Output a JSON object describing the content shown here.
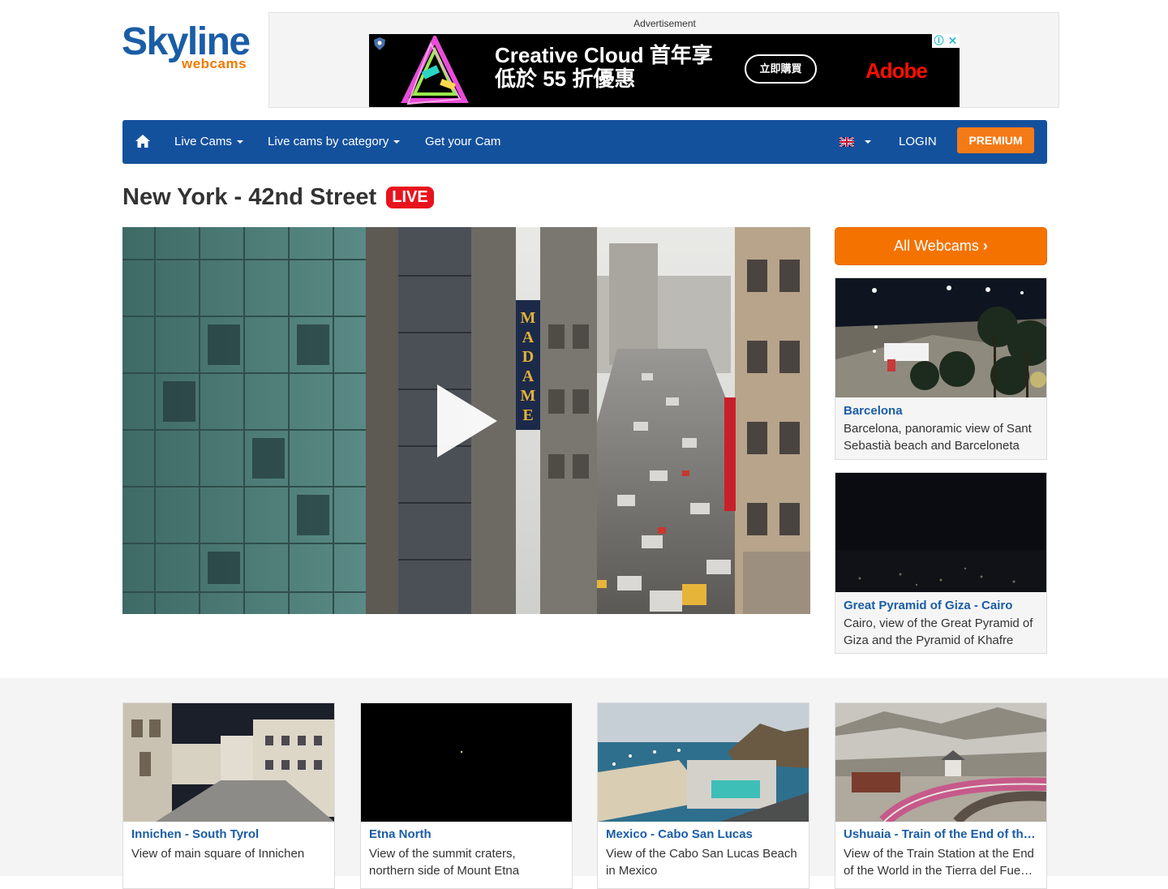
{
  "brand": {
    "logo_main": "Skyline",
    "logo_sub": "webcams"
  },
  "ad": {
    "label": "Advertisement",
    "headline": "Creative Cloud 首年享\n低於 55 折優惠",
    "cta": "立即購買",
    "brand": "Adobe",
    "info_icon": "ⓘ",
    "close_icon": "✕"
  },
  "nav": {
    "home_icon": "home-icon",
    "live_cams": "Live Cams",
    "by_category": "Live cams by category",
    "get_cam": "Get your Cam",
    "language_flag": "uk-flag-icon",
    "login": "LOGIN",
    "premium": "PREMIUM"
  },
  "page": {
    "title": "New York - 42nd Street",
    "live_badge": "LIVE"
  },
  "player": {
    "sign_text": "MADAME",
    "play_icon": "play-icon"
  },
  "sidebar": {
    "all_webcams": "All Webcams",
    "chevron": "›",
    "cards": [
      {
        "title": "Barcelona",
        "desc": "Barcelona, panoramic view of Sant Sebastià beach and Barceloneta"
      },
      {
        "title": "Great Pyramid of Giza - Cairo",
        "desc": "Cairo, view of the Great Pyramid of Giza and the Pyramid of Khafre"
      }
    ]
  },
  "grid": [
    {
      "title": "Innichen - South Tyrol",
      "desc": "View of main square of Innichen"
    },
    {
      "title": "Etna North",
      "desc": "View of the summit craters, northern side of Mount Etna"
    },
    {
      "title": "Mexico - Cabo San Lucas",
      "desc": "View of the Cabo San Lucas Beach in Mexico"
    },
    {
      "title": "Ushuaia - Train of the End of th…",
      "desc": "View of the Train Station at the End of the World in the Tierra del Fue…"
    }
  ],
  "colors": {
    "brand_blue": "#14519d",
    "accent_orange": "#f47300",
    "live_red": "#e8131c",
    "link_blue": "#1a5da6"
  }
}
